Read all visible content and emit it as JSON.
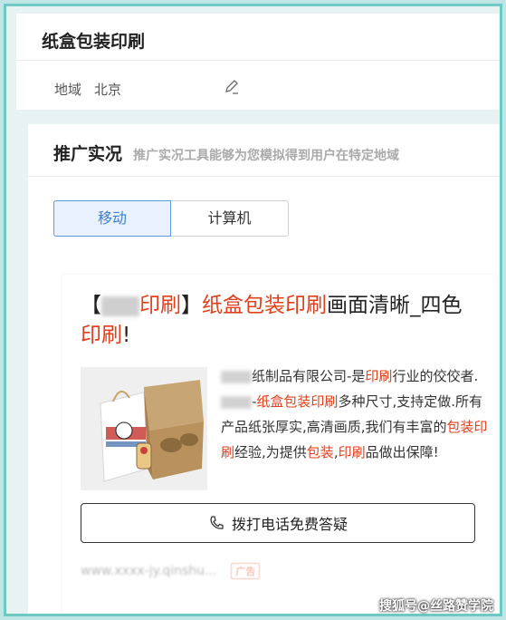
{
  "header": {
    "title": "纸盒包装印刷"
  },
  "region": {
    "label": "地域",
    "value": "北京",
    "edit_icon": "pencil-icon"
  },
  "section": {
    "title": "推广实况",
    "description": "推广实况工具能够为您模拟得到用户在特定地域"
  },
  "device_tabs": [
    {
      "label": "移动",
      "active": true
    },
    {
      "label": "计算机",
      "active": false
    }
  ],
  "ad": {
    "title_parts": [
      {
        "text": "【",
        "style": "normal"
      },
      {
        "text": "",
        "style": "blur"
      },
      {
        "text": "印刷",
        "style": "red"
      },
      {
        "text": "】",
        "style": "normal"
      },
      {
        "text": "纸盒包装印刷",
        "style": "red"
      },
      {
        "text": "画面清晰_四色",
        "style": "normal"
      },
      {
        "text": "印刷",
        "style": "red"
      },
      {
        "text": "!",
        "style": "normal"
      }
    ],
    "desc_parts": [
      {
        "text": "",
        "style": "blur"
      },
      {
        "text": "纸制品有限公司-是",
        "style": "normal"
      },
      {
        "text": "印刷",
        "style": "red"
      },
      {
        "text": "行业的佼佼者.",
        "style": "normal"
      },
      {
        "text": "",
        "style": "blur"
      },
      {
        "text": "-",
        "style": "normal"
      },
      {
        "text": "纸盒包装印刷",
        "style": "red"
      },
      {
        "text": "多种尺寸,支持定做.所有产品纸张厚实,高清画质,我们有丰富的",
        "style": "normal"
      },
      {
        "text": "包装印刷",
        "style": "red"
      },
      {
        "text": "经验,为提供",
        "style": "normal"
      },
      {
        "text": "包装",
        "style": "red"
      },
      {
        "text": ",",
        "style": "normal"
      },
      {
        "text": "印刷",
        "style": "red"
      },
      {
        "text": "品做出保障!",
        "style": "normal"
      }
    ],
    "call_button": "拨打电话免费答疑",
    "call_icon": "phone-icon",
    "url": "www.xxxx-jy.qinshu...",
    "ad_tag": "广告"
  },
  "watermark": "搜狐号@丝路赞学院",
  "colors": {
    "accent_red": "#e0401c",
    "active_blue": "#3d7fd6",
    "frame_teal": "#6fc9c3"
  }
}
